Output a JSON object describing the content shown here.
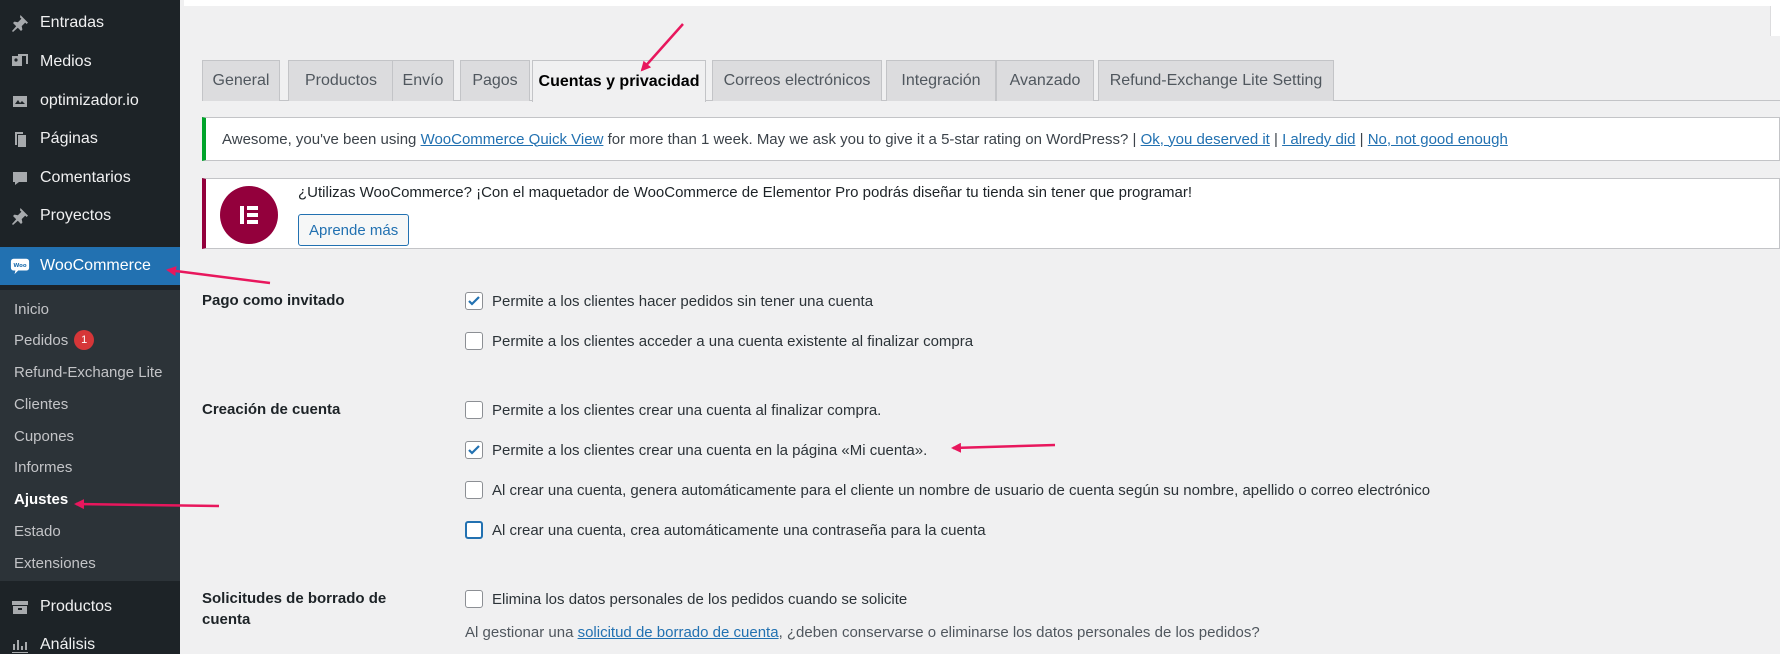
{
  "sidebar": {
    "items": [
      {
        "label": "Entradas",
        "icon": "pushpin-icon"
      },
      {
        "label": "Medios",
        "icon": "media-icon"
      },
      {
        "label": "optimizador.io",
        "icon": "image-gallery-icon"
      },
      {
        "label": "Páginas",
        "icon": "pages-icon"
      },
      {
        "label": "Comentarios",
        "icon": "comment-icon"
      },
      {
        "label": "Proyectos",
        "icon": "pushpin-icon"
      },
      {
        "label": "WooCommerce",
        "icon": "woo-icon"
      },
      {
        "label": "Productos",
        "icon": "archive-icon"
      },
      {
        "label": "Análisis",
        "icon": "chart-icon"
      }
    ],
    "submenu": [
      {
        "label": "Inicio"
      },
      {
        "label": "Pedidos",
        "badge": "1"
      },
      {
        "label": "Refund-Exchange Lite"
      },
      {
        "label": "Clientes"
      },
      {
        "label": "Cupones"
      },
      {
        "label": "Informes"
      },
      {
        "label": "Ajustes"
      },
      {
        "label": "Estado"
      },
      {
        "label": "Extensiones"
      }
    ],
    "woo_logo_text": "Woo"
  },
  "tabs": [
    {
      "label": "General"
    },
    {
      "label": "Productos"
    },
    {
      "label": "Envío"
    },
    {
      "label": "Pagos"
    },
    {
      "label": "Cuentas y privacidad"
    },
    {
      "label": "Correos electrónicos"
    },
    {
      "label": "Integración"
    },
    {
      "label": "Avanzado"
    },
    {
      "label": "Refund-Exchange Lite Setting"
    }
  ],
  "notice_quickview": {
    "text_before": "Awesome, you've been using",
    "link_plugin": "WooCommerce Quick View",
    "text_after": "for more than 1 week. May we ask you to give it a 5-star rating on WordPress? |",
    "link_ok": "Ok, you deserved it",
    "sep1": "|",
    "link_did": "I alredy did",
    "sep2": "|",
    "link_no": "No, not good enough"
  },
  "notice_elementor": {
    "text": "¿Utilizas WooCommerce? ¡Con el maquetador de WooCommerce de Elementor Pro podrás diseñar tu tienda sin tener que programar!",
    "button": "Aprende más"
  },
  "settings": {
    "guest": {
      "label": "Pago como invitado",
      "options": [
        {
          "label": "Permite a los clientes hacer pedidos sin tener una cuenta",
          "checked": true
        },
        {
          "label": "Permite a los clientes acceder a una cuenta existente al finalizar compra",
          "checked": false
        }
      ]
    },
    "account": {
      "label": "Creación de cuenta",
      "options": [
        {
          "label": "Permite a los clientes crear una cuenta al finalizar compra.",
          "checked": false
        },
        {
          "label": "Permite a los clientes crear una cuenta en la página «Mi cuenta».",
          "checked": true
        },
        {
          "label": "Al crear una cuenta, genera automáticamente para el cliente un nombre de usuario de cuenta según su nombre, apellido o correo electrónico",
          "checked": false
        },
        {
          "label": "Al crear una cuenta, crea automáticamente una contraseña para la cuenta",
          "checked": false
        }
      ]
    },
    "erasure": {
      "label": "Solicitudes de borrado de cuenta",
      "options": [
        {
          "label": "Elimina los datos personales de los pedidos cuando se solicite",
          "checked": false
        }
      ],
      "desc_before": "Al gestionar una",
      "desc_link": "solicitud de borrado de cuenta",
      "desc_after": ", ¿deben conservarse o eliminarse los datos personales de los pedidos?"
    }
  },
  "colors": {
    "sidebar_bg": "#1d2327",
    "accent": "#2271b1",
    "annotation_arrow": "#e8175d",
    "elementor": "#93003c"
  }
}
